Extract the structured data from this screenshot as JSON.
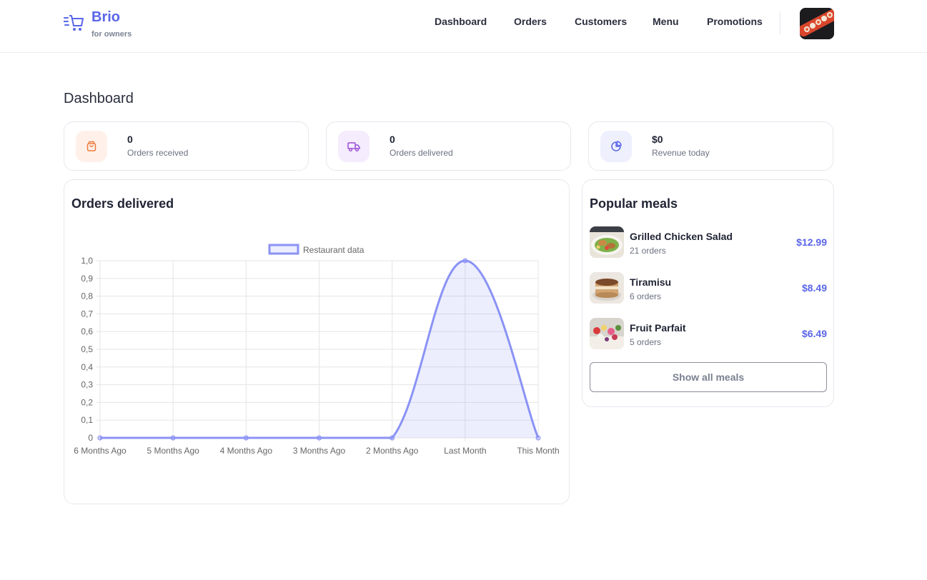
{
  "brand": {
    "name": "Brio",
    "subtitle": "for owners",
    "accent": "#5a66e8"
  },
  "nav": {
    "items": [
      "Dashboard",
      "Orders",
      "Customers",
      "Menu",
      "Promotions"
    ]
  },
  "page": {
    "title": "Dashboard"
  },
  "stats": [
    {
      "value": "0",
      "label": "Orders received",
      "icon": "shopping-bag-icon",
      "color": "#f07a3c",
      "bg": "#fff1ea"
    },
    {
      "value": "0",
      "label": "Orders delivered",
      "icon": "truck-icon",
      "color": "#9b4fd8",
      "bg": "#f5ecfd"
    },
    {
      "value": "$0",
      "label": "Revenue today",
      "icon": "pie-chart-icon",
      "color": "#5a66e8",
      "bg": "#eef0fd"
    }
  ],
  "orders_card": {
    "title": "Orders delivered"
  },
  "chart_data": {
    "type": "line",
    "categories": [
      "6 Months Ago",
      "5 Months Ago",
      "4 Months Ago",
      "3 Months Ago",
      "2 Months Ago",
      "Last Month",
      "This Month"
    ],
    "series": [
      {
        "name": "Restaurant data",
        "values": [
          0,
          0,
          0,
          0,
          0,
          1,
          0
        ],
        "color": "#8b93f5"
      }
    ],
    "y_ticks": [
      "0",
      "0,1",
      "0,2",
      "0,3",
      "0,4",
      "0,5",
      "0,6",
      "0,7",
      "0,8",
      "0,9",
      "1,0"
    ],
    "ylim": [
      0,
      1
    ],
    "grid": true,
    "legend": "top-center",
    "fill": true
  },
  "meals": {
    "title": "Popular meals",
    "items": [
      {
        "name": "Grilled Chicken Salad",
        "orders": "21 orders",
        "price": "$12.99"
      },
      {
        "name": "Tiramisu",
        "orders": "6 orders",
        "price": "$8.49"
      },
      {
        "name": "Fruit Parfait",
        "orders": "5 orders",
        "price": "$6.49"
      }
    ],
    "show_all_label": "Show all meals"
  }
}
